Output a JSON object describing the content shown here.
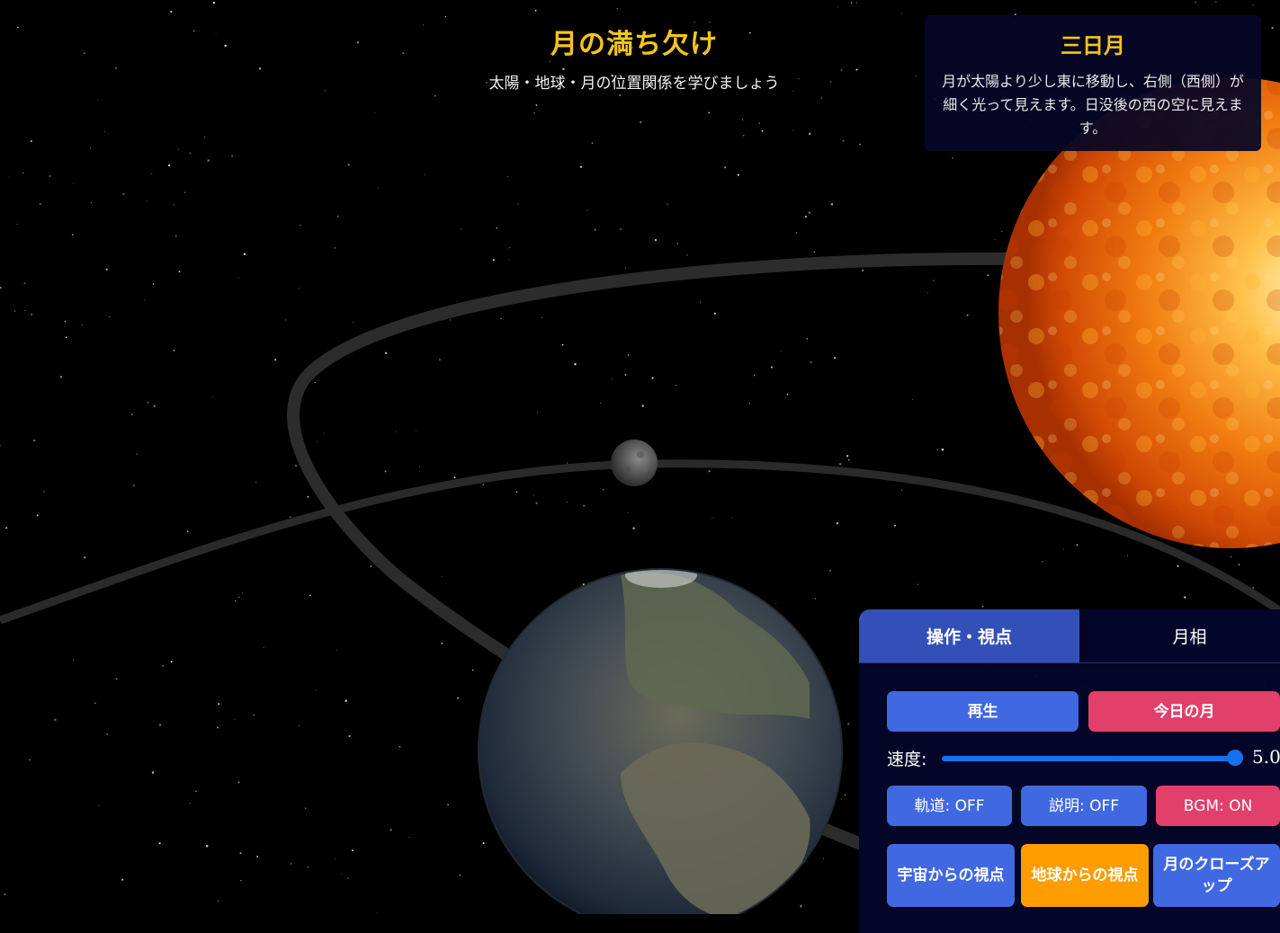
{
  "header": {
    "title": "月の満ち欠け",
    "subtitle": "太陽・地球・月の位置関係を学びましょう"
  },
  "phase_info": {
    "name": "三日月",
    "description": "月が太陽より少し東に移動し、右側（西側）が細く光って見えます。日没後の西の空に見えます。"
  },
  "control_panel": {
    "tabs": [
      {
        "label": "操作・視点",
        "active": true
      },
      {
        "label": "月相",
        "active": false
      }
    ],
    "play_label": "再生",
    "today_moon_label": "今日の月",
    "speed_label": "速度:",
    "speed_value": "5.0",
    "speed_fraction": 1.0,
    "toggles": {
      "orbit": "軌道: OFF",
      "explanation": "説明: OFF",
      "bgm": "BGM: ON"
    },
    "views": {
      "space": "宇宙からの視点",
      "earth": "地球からの視点",
      "moon_closeup": "月のクローズアップ"
    }
  },
  "colors": {
    "accent_yellow": "#f5c518",
    "button_blue": "#4068e0",
    "button_red": "#e0406a",
    "button_orange": "#ff9d00",
    "tab_active": "#3350b8",
    "slider": "#1670f0"
  }
}
